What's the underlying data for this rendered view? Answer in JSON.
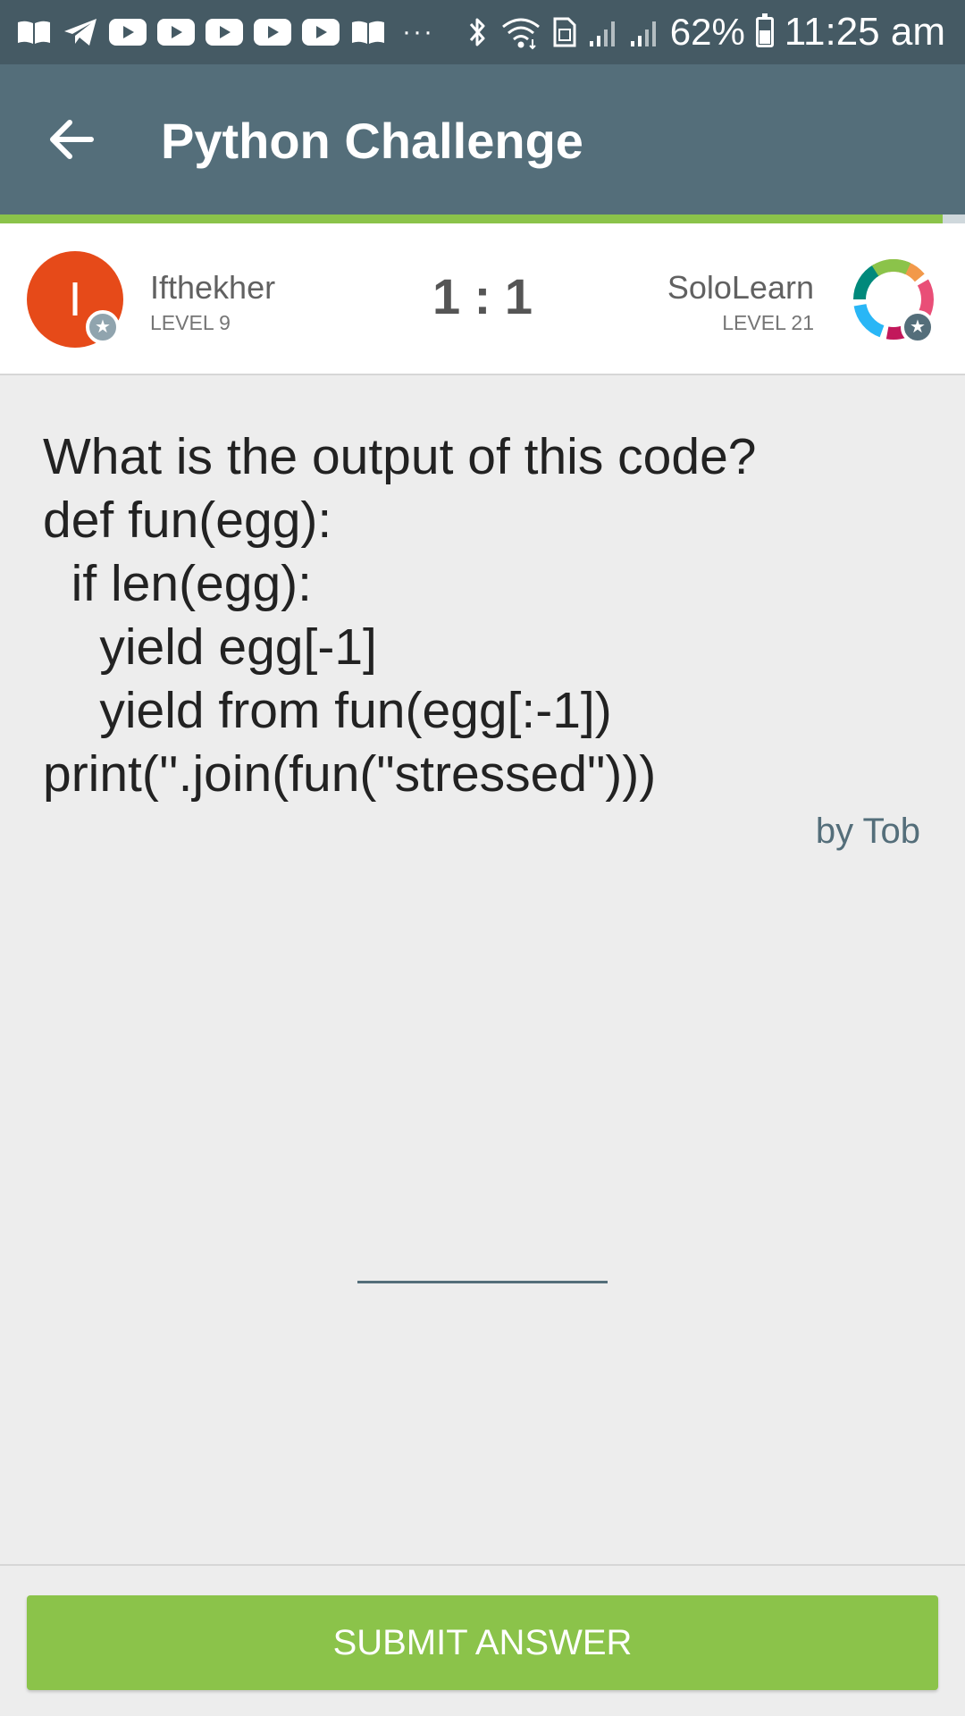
{
  "status_bar": {
    "notification_icons": [
      "book-icon",
      "telegram-icon",
      "youtube-icon",
      "youtube-icon",
      "youtube-icon",
      "youtube-icon",
      "youtube-icon",
      "book-icon"
    ],
    "more_indicator": "···",
    "battery_percent": "62%",
    "time": "11:25 am"
  },
  "app_bar": {
    "title": "Python Challenge",
    "back_icon": "arrow-left-icon"
  },
  "progress": {
    "fraction": 0.977,
    "color": "#8bc34a"
  },
  "players": {
    "left": {
      "initial": "I",
      "name": "Ifthekher",
      "level": "LEVEL 9",
      "avatar_color": "#e64a19"
    },
    "right": {
      "name": "SoloLearn",
      "level": "LEVEL 21",
      "avatar_icon": "sololearn-logo"
    },
    "score": "1 : 1"
  },
  "question": {
    "text": "What is the output of this code?\ndef fun(egg):\n  if len(egg):\n    yield egg[-1]\n    yield from fun(egg[:-1])\nprint(''.join(fun(\"stressed\")))",
    "author": "by Tob"
  },
  "answer": {
    "value": ""
  },
  "footer": {
    "submit_label": "SUBMIT ANSWER"
  },
  "colors": {
    "status_bar": "#455a64",
    "app_bar": "#546e7a",
    "accent": "#8bc34a",
    "background": "#ededed"
  }
}
